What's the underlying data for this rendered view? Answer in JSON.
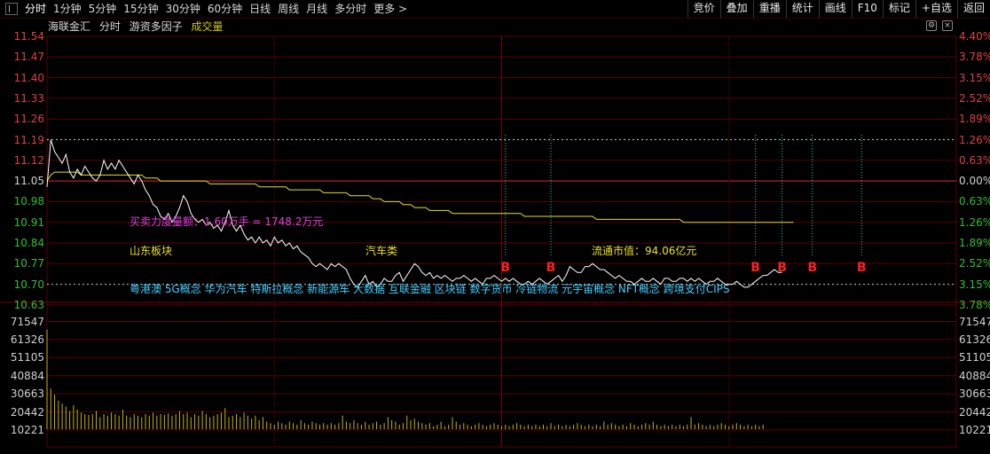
{
  "toolbar": {
    "tabs": [
      "分时",
      "1分钟",
      "5分钟",
      "15分钟",
      "30分钟",
      "60分钟",
      "日线",
      "周线",
      "月线",
      "多分时",
      "更多 >"
    ],
    "right_buttons": [
      "竞价",
      "叠加",
      "重播",
      "统计",
      "画线",
      "F10",
      "标记",
      "+自选",
      "返回"
    ]
  },
  "header": {
    "stock_name": "海联金汇",
    "mode": "分时",
    "indicator": "游资多因子",
    "volume_label": "成交量",
    "btn_settings": "⚙",
    "btn_close": "×"
  },
  "price_axis": {
    "left": [
      "11.54",
      "11.47",
      "11.40",
      "11.33",
      "11.26",
      "11.19",
      "11.12",
      "11.05",
      "10.98",
      "10.91",
      "10.84",
      "10.77",
      "10.70",
      "10.63"
    ],
    "right": [
      "4.40%",
      "3.78%",
      "3.15%",
      "2.52%",
      "1.89%",
      "1.26%",
      "0.63%",
      "0.00%",
      "0.63%",
      "1.26%",
      "1.89%",
      "2.52%",
      "3.15%",
      "3.78%"
    ]
  },
  "volume_axis": {
    "left": [
      "71547",
      "61326",
      "51105",
      "40884",
      "30663",
      "20442",
      "10221"
    ],
    "right": [
      "71547",
      "61326",
      "51105",
      "40884",
      "30663",
      "20442",
      "10221"
    ]
  },
  "annotations": {
    "buy_sell_power": "买卖力度量额：1.60万手 = 1748.2万元",
    "sector": "山东板块",
    "industry": "汽车类",
    "float_cap": "流通市值：94.06亿元",
    "concepts": "粤港澳 5G概念 华为汽车 特斯拉概念 新能源车 大数据 互联金融 区块链 数字货币 冷链物流 元宇宙概念 NFT概念 跨境支付CIPS",
    "signal_label": "B"
  },
  "chart_data": {
    "type": "line",
    "price_ylim": [
      10.63,
      11.54
    ],
    "prev_close": 11.05,
    "minutes_total": 240,
    "price": [
      11.03,
      11.19,
      11.15,
      11.13,
      11.11,
      11.14,
      11.08,
      11.06,
      11.09,
      11.07,
      11.1,
      11.08,
      11.06,
      11.05,
      11.07,
      11.12,
      11.09,
      11.11,
      11.09,
      11.12,
      11.1,
      11.08,
      11.06,
      11.04,
      11.07,
      11.05,
      11.02,
      11.0,
      10.97,
      10.96,
      10.93,
      10.92,
      10.94,
      10.91,
      10.93,
      10.96,
      11.0,
      10.98,
      10.94,
      10.92,
      10.91,
      10.92,
      10.9,
      10.91,
      10.89,
      10.9,
      10.88,
      10.91,
      10.95,
      10.9,
      10.88,
      10.9,
      10.87,
      10.85,
      10.86,
      10.84,
      10.86,
      10.84,
      10.85,
      10.83,
      10.86,
      10.84,
      10.85,
      10.83,
      10.84,
      10.82,
      10.83,
      10.81,
      10.8,
      10.79,
      10.77,
      10.76,
      10.77,
      10.76,
      10.75,
      10.77,
      10.76,
      10.77,
      10.76,
      10.75,
      10.72,
      10.7,
      10.69,
      10.71,
      10.73,
      10.7,
      10.71,
      10.69,
      10.7,
      10.72,
      10.71,
      10.71,
      10.73,
      10.74,
      10.71,
      10.73,
      10.75,
      10.77,
      10.76,
      10.74,
      10.73,
      10.74,
      10.72,
      10.73,
      10.72,
      10.73,
      10.72,
      10.71,
      10.72,
      10.72,
      10.73,
      10.72,
      10.71,
      10.72,
      10.71,
      10.7,
      10.72,
      10.72,
      10.73,
      10.72,
      10.71,
      10.72,
      10.71,
      10.72,
      10.71,
      10.7,
      10.7,
      10.71,
      10.7,
      10.71,
      10.72,
      10.71,
      10.7,
      10.71,
      10.72,
      10.73,
      10.71,
      10.73,
      10.76,
      10.75,
      10.74,
      10.74,
      10.76,
      10.76,
      10.77,
      10.76,
      10.75,
      10.75,
      10.74,
      10.73,
      10.72,
      10.73,
      10.72,
      10.71,
      10.71,
      10.7,
      10.71,
      10.72,
      10.71,
      10.71,
      10.72,
      10.71,
      10.7,
      10.72,
      10.72,
      10.71,
      10.71,
      10.72,
      10.72,
      10.71,
      10.72,
      10.71,
      10.72,
      10.71,
      10.7,
      10.71,
      10.71,
      10.72,
      10.71,
      10.7,
      10.7,
      10.7,
      10.71,
      10.7,
      10.69,
      10.69,
      10.7,
      10.71,
      10.72,
      10.73,
      10.73,
      10.74,
      10.75,
      10.74,
      10.74
    ],
    "avg_price": [
      11.05,
      11.07,
      11.08,
      11.08,
      11.08,
      11.08,
      11.08,
      11.08,
      11.08,
      11.07,
      11.07,
      11.07,
      11.07,
      11.07,
      11.07,
      11.07,
      11.07,
      11.07,
      11.07,
      11.07,
      11.07,
      11.07,
      11.07,
      11.07,
      11.07,
      11.07,
      11.06,
      11.06,
      11.06,
      11.06,
      11.05,
      11.05,
      11.05,
      11.05,
      11.05,
      11.05,
      11.05,
      11.05,
      11.05,
      11.05,
      11.05,
      11.05,
      11.05,
      11.04,
      11.04,
      11.04,
      11.04,
      11.04,
      11.04,
      11.04,
      11.04,
      11.04,
      11.04,
      11.04,
      11.04,
      11.04,
      11.03,
      11.03,
      11.03,
      11.03,
      11.03,
      11.03,
      11.03,
      11.03,
      11.02,
      11.02,
      11.02,
      11.02,
      11.02,
      11.02,
      11.02,
      11.02,
      11.02,
      11.01,
      11.01,
      11.01,
      11.01,
      11.01,
      11.01,
      11.01,
      11.0,
      11.0,
      11.0,
      11.0,
      11.0,
      11.0,
      10.99,
      10.99,
      10.99,
      10.98,
      10.98,
      10.98,
      10.98,
      10.98,
      10.97,
      10.97,
      10.97,
      10.96,
      10.96,
      10.96,
      10.96,
      10.95,
      10.95,
      10.95,
      10.95,
      10.95,
      10.95,
      10.94,
      10.94,
      10.94,
      10.94,
      10.94,
      10.94,
      10.94,
      10.94,
      10.94,
      10.94,
      10.94,
      10.94,
      10.94,
      10.94,
      10.94,
      10.94,
      10.94,
      10.94,
      10.94,
      10.93,
      10.93,
      10.93,
      10.93,
      10.93,
      10.93,
      10.93,
      10.93,
      10.93,
      10.93,
      10.93,
      10.93,
      10.93,
      10.93,
      10.93,
      10.93,
      10.93,
      10.93,
      10.93,
      10.92,
      10.92,
      10.92,
      10.92,
      10.92,
      10.92,
      10.92,
      10.92,
      10.92,
      10.92,
      10.92,
      10.92,
      10.92,
      10.92,
      10.92,
      10.92,
      10.92,
      10.92,
      10.92,
      10.92,
      10.92,
      10.92,
      10.92,
      10.91,
      10.91,
      10.91,
      10.91,
      10.91,
      10.91,
      10.91,
      10.91,
      10.91,
      10.91,
      10.91,
      10.91,
      10.91,
      10.91,
      10.91,
      10.91,
      10.91,
      10.91,
      10.91,
      10.91,
      10.91,
      10.91,
      10.91,
      10.91,
      10.91,
      10.91,
      10.91,
      10.91,
      10.91,
      10.91
    ],
    "volume_ylim": [
      0,
      71547
    ],
    "volume": [
      66000,
      27000,
      23000,
      19000,
      17000,
      15000,
      12000,
      16000,
      13000,
      11000,
      10000,
      9500,
      10000,
      12000,
      8000,
      10000,
      9000,
      11000,
      10000,
      9000,
      13000,
      9000,
      8000,
      10000,
      9000,
      8000,
      10000,
      9000,
      11000,
      9000,
      10000,
      9500,
      10500,
      9000,
      10000,
      12000,
      10000,
      11000,
      8000,
      10000,
      9000,
      12000,
      10000,
      8000,
      9000,
      10000,
      11000,
      14000,
      8000,
      9000,
      10000,
      8000,
      11000,
      9000,
      7000,
      9000,
      6000,
      8000,
      5000,
      4000,
      3000,
      5000,
      4000,
      3000,
      5000,
      4000,
      3000,
      6000,
      4000,
      3000,
      5000,
      4000,
      3000,
      4000,
      3000,
      4000,
      3000,
      4000,
      9000,
      5000,
      4000,
      6000,
      4000,
      3000,
      5000,
      3000,
      4000,
      5000,
      3000,
      4000,
      8000,
      6000,
      5000,
      3000,
      4000,
      9000,
      6000,
      7000,
      5000,
      4000,
      3000,
      4000,
      2000,
      3000,
      5000,
      2000,
      3000,
      8000,
      5000,
      3000,
      4000,
      3000,
      2000,
      3000,
      4000,
      3000,
      2000,
      3000,
      4000,
      3000,
      2000,
      3000,
      2000,
      3000,
      4000,
      3000,
      2000,
      3000,
      2000,
      3000,
      2000,
      3000,
      2000,
      4000,
      2000,
      3000,
      2000,
      3000,
      2000,
      3000,
      4000,
      3000,
      2000,
      3000,
      2000,
      3000,
      2000,
      5000,
      3000,
      4000,
      3000,
      2000,
      3000,
      2000,
      4000,
      3000,
      2000,
      3000,
      4000,
      3000,
      5000,
      3000,
      2000,
      3000,
      2000,
      3000,
      2000,
      3000,
      2000,
      3000,
      8000,
      3000,
      4000,
      3000,
      2000,
      3000,
      2000,
      3000,
      4000,
      3000,
      2000,
      3000,
      4000,
      3000,
      2000,
      3000,
      2000,
      3000,
      2000,
      3000
    ],
    "buy_signals_minute": [
      121,
      133,
      187,
      194,
      202,
      215
    ]
  },
  "colors": {
    "grid": "#5a0000",
    "price_line": "#ffffff",
    "avg_line": "#e8e020",
    "volume_bar": "#c8b400",
    "axis_up": "#e04040",
    "axis_down": "#30c030",
    "signal": "#ff2020",
    "signal_line": "#40c0c0",
    "magenta": "#e040e0",
    "cyan": "#40d0ff",
    "yellow": "#e8e020"
  }
}
